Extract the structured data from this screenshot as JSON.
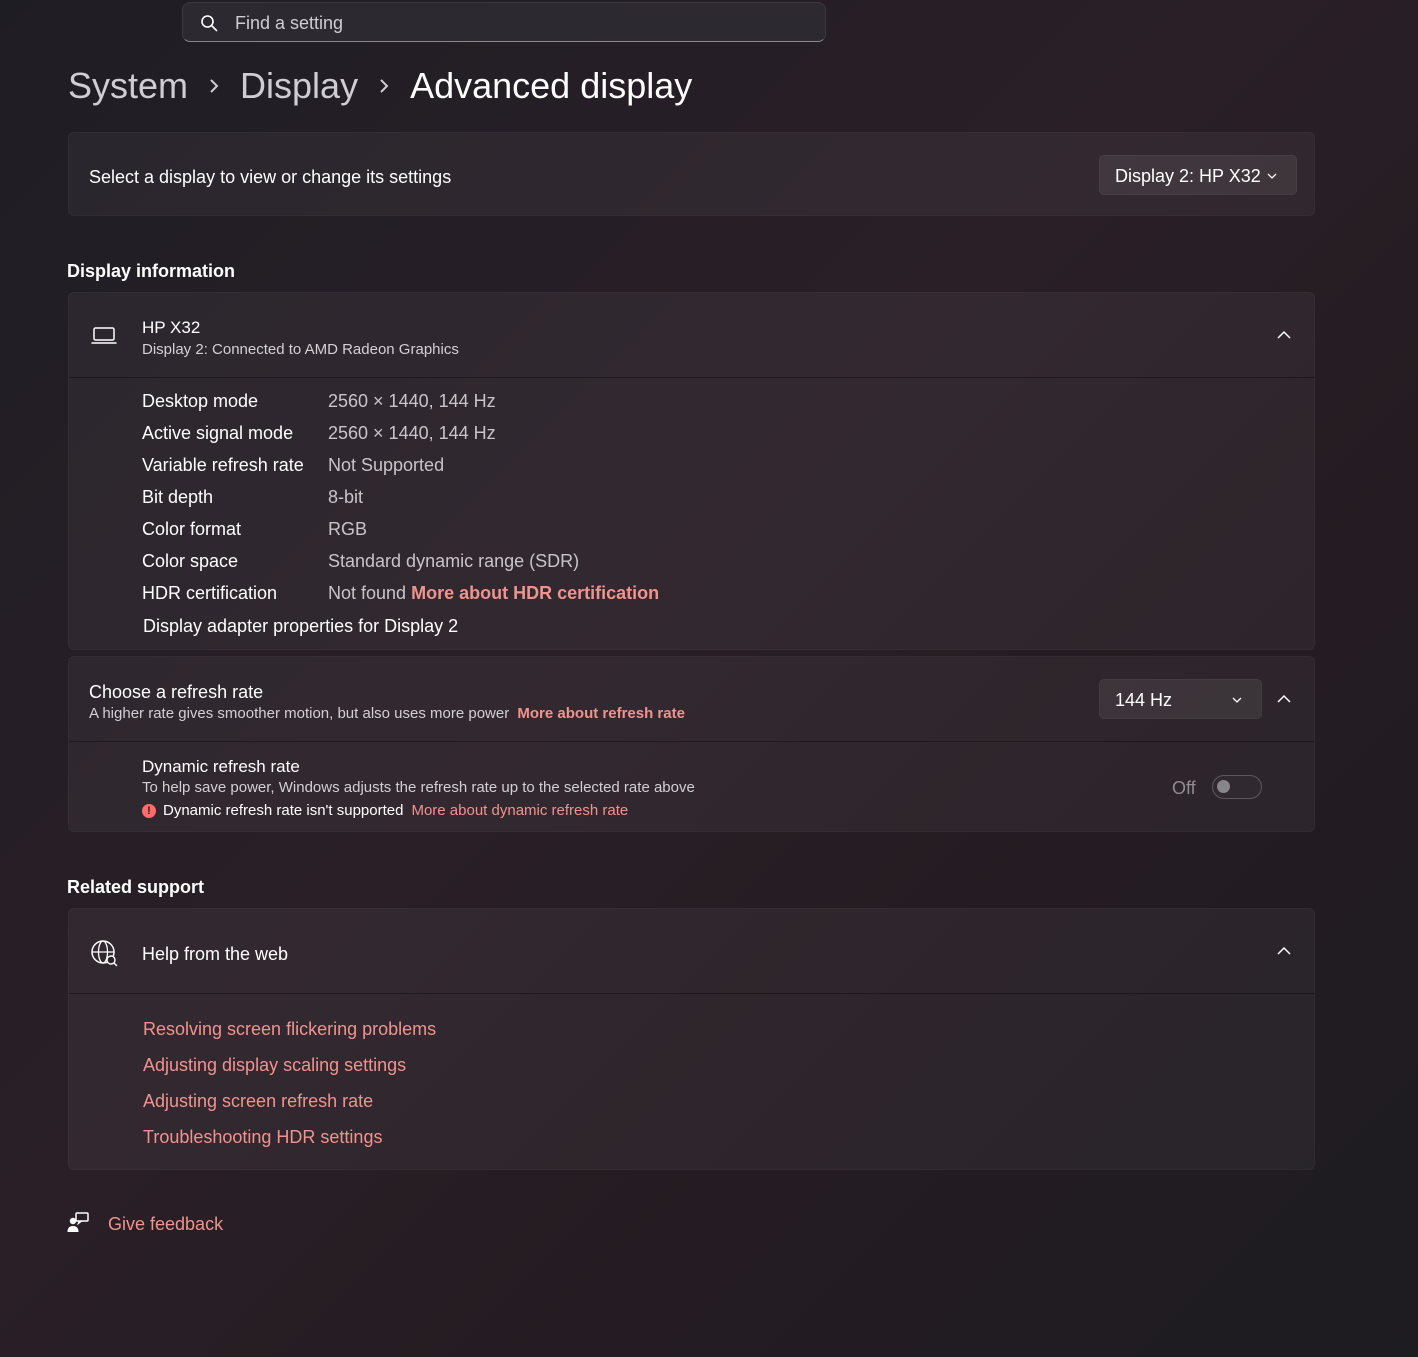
{
  "search": {
    "placeholder": "Find a setting"
  },
  "breadcrumb": [
    "System",
    "Display",
    "Advanced display"
  ],
  "display_select": {
    "label": "Select a display to view or change its settings",
    "selected": "Display 2: HP X32"
  },
  "display_information": {
    "section_title": "Display information",
    "monitor_name": "HP X32",
    "monitor_sub": "Display 2: Connected to AMD Radeon Graphics",
    "rows": [
      {
        "key": "Desktop mode",
        "value": "2560 × 1440, 144 Hz"
      },
      {
        "key": "Active signal mode",
        "value": "2560 × 1440, 144 Hz"
      },
      {
        "key": "Variable refresh rate",
        "value": "Not Supported"
      },
      {
        "key": "Bit depth",
        "value": "8-bit"
      },
      {
        "key": "Color format",
        "value": "RGB"
      },
      {
        "key": "Color space",
        "value": "Standard dynamic range (SDR)"
      },
      {
        "key": "HDR certification",
        "value": "Not found",
        "link": "More about HDR certification"
      }
    ],
    "adapter_link": "Display adapter properties for Display 2"
  },
  "refresh_rate": {
    "title": "Choose a refresh rate",
    "description": "A higher rate gives smoother motion, but also uses more power",
    "link": "More about refresh rate",
    "selected": "144 Hz",
    "dynamic": {
      "title": "Dynamic refresh rate",
      "description": "To help save power, Windows adjusts the refresh rate up to the selected rate above",
      "warning": "Dynamic refresh rate isn't supported",
      "link": "More about dynamic refresh rate",
      "toggle_label": "Off",
      "toggle_on": false
    }
  },
  "related_support": {
    "section_title": "Related support",
    "help_title": "Help from the web",
    "links": [
      "Resolving screen flickering problems",
      "Adjusting display scaling settings",
      "Adjusting screen refresh rate",
      "Troubleshooting HDR settings"
    ]
  },
  "feedback": {
    "label": "Give feedback"
  },
  "colors": {
    "accent": "#f0938f",
    "background": "#201d24",
    "warning": "#ff6b6b"
  },
  "icons": [
    "search-icon",
    "chevron-right-icon",
    "chevron-down-icon",
    "chevron-up-icon",
    "laptop-icon",
    "warning-icon",
    "globe-icon",
    "feedback-icon"
  ]
}
